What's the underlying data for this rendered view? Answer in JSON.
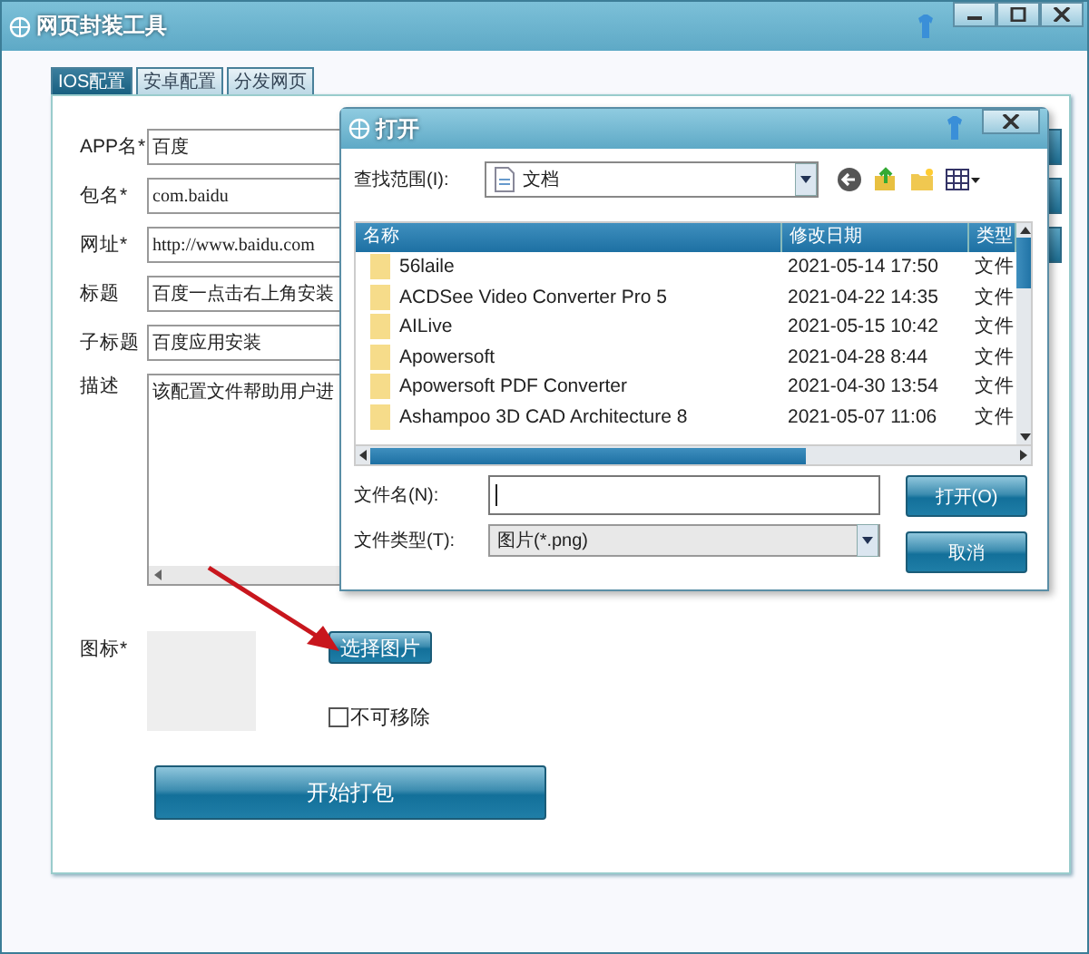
{
  "window": {
    "title": "网页封装工具"
  },
  "tabs": [
    {
      "label": "IOS配置",
      "selected": true
    },
    {
      "label": "安卓配置",
      "selected": false
    },
    {
      "label": "分发网页",
      "selected": false
    }
  ],
  "form": {
    "fields": [
      {
        "label": "APP名*",
        "value": "百度",
        "kind": "input_with_button"
      },
      {
        "label": "包名*",
        "value": "com.baidu",
        "kind": "input_with_button"
      },
      {
        "label": "网址*",
        "value": "http://www.baidu.com",
        "kind": "input_with_button"
      },
      {
        "label": "标题",
        "value": "百度一点击右上角安装",
        "kind": "input"
      },
      {
        "label": "子标题",
        "value": "百度应用安装",
        "kind": "input"
      },
      {
        "label": "描述",
        "value": "该配置文件帮助用户进",
        "kind": "textarea"
      }
    ],
    "icon_label": "图标*",
    "choose_button": "选择图片",
    "checkbox": {
      "label": "不可移除",
      "checked": false
    },
    "submit_button": "开始打包"
  },
  "dialog": {
    "title": "打开",
    "look_in_label": "查找范围(I):",
    "look_in_value": "文档",
    "columns": [
      "名称",
      "修改日期",
      "类型"
    ],
    "files": [
      {
        "name": "56laile",
        "date": "2021-05-14 17:50",
        "type": "文件"
      },
      {
        "name": "ACDSee Video Converter Pro 5",
        "date": "2021-04-22 14:35",
        "type": "文件"
      },
      {
        "name": "AILive",
        "date": "2021-05-15 10:42",
        "type": "文件"
      },
      {
        "name": "Apowersoft",
        "date": "2021-04-28 8:44",
        "type": "文件"
      },
      {
        "name": "Apowersoft PDF Converter",
        "date": "2021-04-30 13:54",
        "type": "文件"
      },
      {
        "name": "Ashampoo 3D CAD Architecture 8",
        "date": "2021-05-07 11:06",
        "type": "文件"
      }
    ],
    "filename_label": "文件名(N):",
    "filetype_label": "文件类型(T):",
    "filetype_value": "图片(*.png)",
    "open_button": "打开(O)",
    "cancel_button": "取消"
  }
}
